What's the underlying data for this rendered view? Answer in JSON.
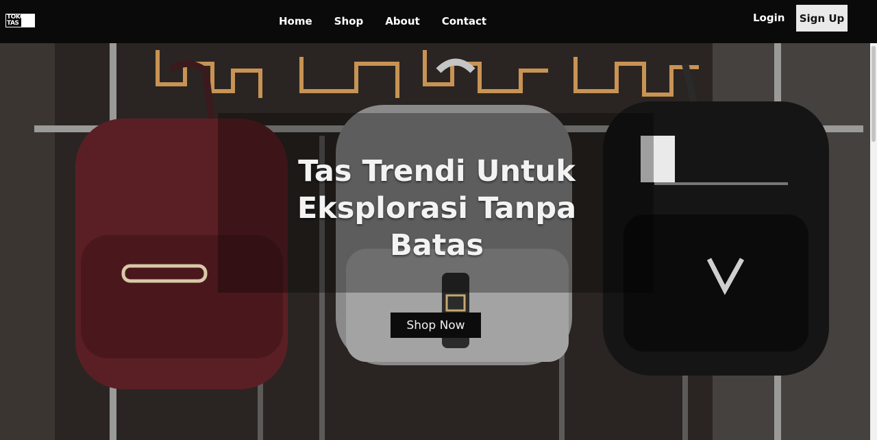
{
  "logo": {
    "line1": "TOKO",
    "line2": "TAS"
  },
  "nav": {
    "links": [
      "Home",
      "Shop",
      "About",
      "Contact"
    ]
  },
  "auth": {
    "login_label": "Login",
    "signup_label": "Sign Up"
  },
  "hero": {
    "title": "Tas Trendi Untuk Eksplorasi Tanpa Batas",
    "cta_label": "Shop Now"
  }
}
